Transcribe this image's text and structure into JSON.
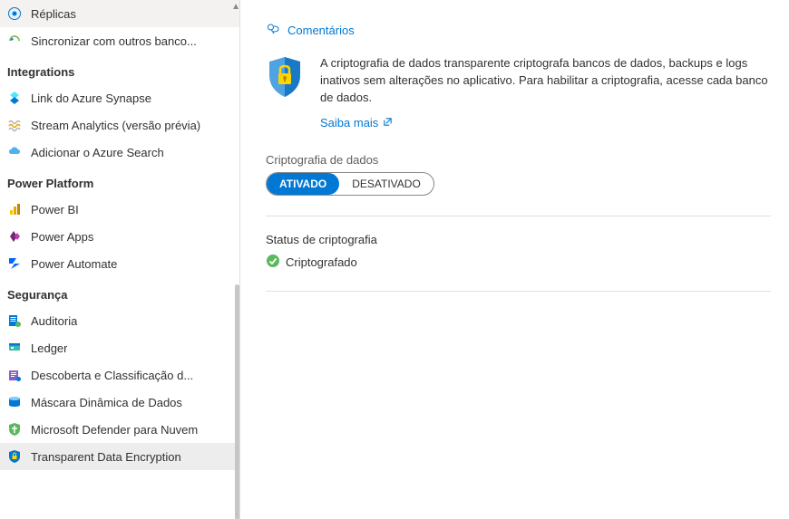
{
  "sidebar": {
    "items": [
      {
        "label": "Réplicas",
        "icon": "replicas-icon"
      },
      {
        "label": "Sincronizar com outros banco...",
        "icon": "sync-icon"
      }
    ],
    "sections": [
      {
        "title": "Integrations",
        "items": [
          {
            "label": "Link do Azure Synapse",
            "icon": "synapse-icon"
          },
          {
            "label": "Stream Analytics (versão prévia)",
            "icon": "stream-icon"
          },
          {
            "label": "Adicionar o Azure Search",
            "icon": "search-cloud-icon"
          }
        ]
      },
      {
        "title": "Power Platform",
        "items": [
          {
            "label": "Power BI",
            "icon": "powerbi-icon"
          },
          {
            "label": "Power Apps",
            "icon": "powerapps-icon"
          },
          {
            "label": "Power Automate",
            "icon": "powerautomate-icon"
          }
        ]
      },
      {
        "title": "Segurança",
        "items": [
          {
            "label": "Auditoria",
            "icon": "audit-icon"
          },
          {
            "label": "Ledger",
            "icon": "ledger-icon"
          },
          {
            "label": "Descoberta e Classificação d...",
            "icon": "classification-icon"
          },
          {
            "label": "Máscara Dinâmica de Dados",
            "icon": "mask-icon"
          },
          {
            "label": "Microsoft Defender para Nuvem",
            "icon": "defender-icon"
          },
          {
            "label": "Transparent Data Encryption",
            "icon": "tde-icon",
            "selected": true
          }
        ]
      }
    ]
  },
  "main": {
    "comments_label": "Comentários",
    "info_text": "A criptografia de dados transparente criptografa bancos de dados, backups e logs inativos sem alterações no aplicativo. Para habilitar a criptografia, acesse cada banco de dados.",
    "learn_more": "Saiba mais",
    "toggle_label": "Criptografia de dados",
    "toggle_on": "ATIVADO",
    "toggle_off": "DESATIVADO",
    "status_label": "Status de criptografia",
    "status_value": "Criptografado"
  }
}
